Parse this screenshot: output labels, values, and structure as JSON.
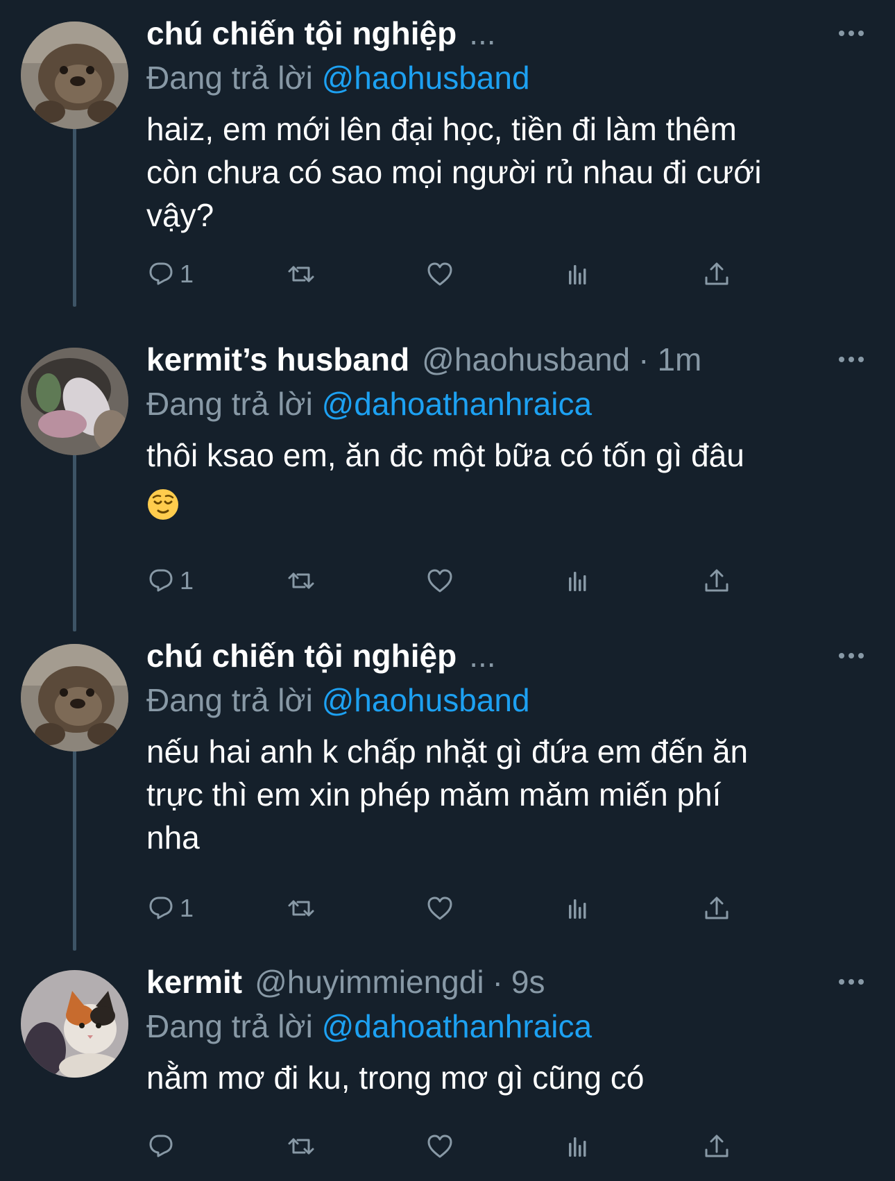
{
  "colors": {
    "background": "#15202b",
    "text": "#ffffff",
    "secondary": "#8899a6",
    "link": "#1da1f2",
    "thread_line": "#3d5466"
  },
  "tweets": [
    {
      "display_name": "chú chiến tội nghiệp",
      "ellipsis": "...",
      "reply_prefix": "Đang trả lời",
      "reply_to": "@haohusband",
      "text_lines": [
        "haiz, em mới lên đại học, tiền đi làm thêm",
        "còn chưa có sao mọi người rủ nhau đi cưới",
        "vậy?"
      ],
      "reply_count": "1",
      "avatar": "otter"
    },
    {
      "display_name": "kermit’s husband",
      "handle": "@haohusband",
      "separator": "·",
      "time": "1m",
      "reply_prefix": "Đang trả lời",
      "reply_to": "@dahoathanhraica",
      "text_lines": [
        "thôi ksao em, ăn đc một bữa có tốn gì đâu"
      ],
      "emoji": "relieved-face",
      "reply_count": "1",
      "avatar": "blurred-cat"
    },
    {
      "display_name": "chú chiến tội nghiệp",
      "ellipsis": "...",
      "reply_prefix": "Đang trả lời",
      "reply_to": "@haohusband",
      "text_lines": [
        "nếu hai anh k chấp nhặt gì đứa em đến ăn",
        "trực thì em xin phép măm măm miến phí",
        "nha"
      ],
      "reply_count": "1",
      "avatar": "otter"
    },
    {
      "display_name": "kermit",
      "handle": "@huyimmiengdi",
      "separator": "·",
      "time": "9s",
      "reply_prefix": "Đang trả lời",
      "reply_to": "@dahoathanhraica",
      "text_lines": [
        "nằm mơ đi ku, trong mơ gì cũng có"
      ],
      "reply_count": "",
      "avatar": "calico-cat"
    }
  ],
  "icons": {
    "reply": "reply-icon",
    "retweet": "retweet-icon",
    "like": "like-icon",
    "analytics": "analytics-icon",
    "share": "share-icon",
    "more": "more-icon"
  }
}
